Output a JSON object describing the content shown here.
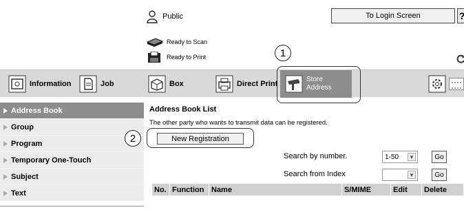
{
  "header": {
    "user_label": "Public",
    "login_button": "To Login Screen",
    "help_button": "?",
    "status_scan": "Ready to Scan",
    "status_print": "Ready to Print"
  },
  "markers": {
    "one": "1",
    "two": "2"
  },
  "tabs": [
    {
      "label": "Information",
      "icon": "information-icon"
    },
    {
      "label": "Job",
      "icon": "job-icon"
    },
    {
      "label": "Box",
      "icon": "box-icon"
    },
    {
      "label": "Direct Print",
      "icon": "direct-print-icon"
    },
    {
      "label_line1": "Store",
      "label_line2": "Address",
      "icon": "store-address-icon",
      "active": true
    }
  ],
  "sidebar": {
    "items": [
      {
        "label": "Address Book",
        "active": true
      },
      {
        "label": "Group"
      },
      {
        "label": "Program"
      },
      {
        "label": "Temporary One-Touch"
      },
      {
        "label": "Subject"
      },
      {
        "label": "Text"
      }
    ]
  },
  "main": {
    "title": "Address Book List",
    "description": "The other party who wants to transmit data can be registered.",
    "new_registration_button": "New Registration",
    "search_by_number_label": "Search by number.",
    "search_by_number_value": "1-50",
    "search_from_index_label": "Search from Index",
    "search_from_index_value": "",
    "go_label": "Go",
    "columns": [
      "No.",
      "Function",
      "Name",
      "S/MIME",
      "Edit",
      "Delete"
    ]
  },
  "colors": {
    "active_tab": "#8d8d8d",
    "tab_bar": "#d9d9d9",
    "sidebar_item": "#ebebeb",
    "list_header": "#d0d0d0"
  }
}
